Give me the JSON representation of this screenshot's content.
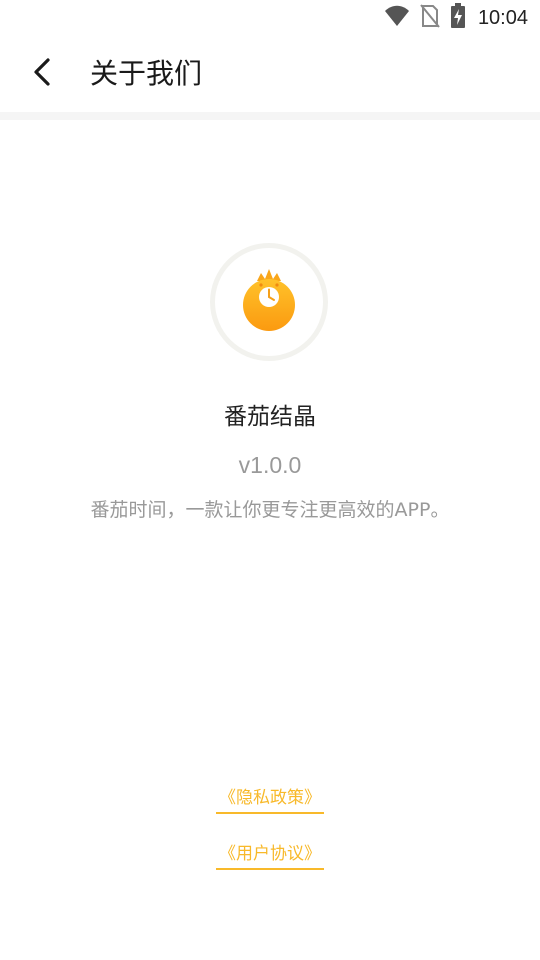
{
  "status_bar": {
    "time": "10:04",
    "icons": [
      "wifi-icon",
      "no-sim-icon",
      "battery-charging-icon"
    ]
  },
  "app_bar": {
    "back_icon": "chevron-left-icon",
    "title": "关于我们"
  },
  "about": {
    "logo_icon": "tomato-clock-logo",
    "app_name": "番茄结晶",
    "version": "v1.0.0",
    "description": "番茄时间，一款让你更专注更高效的APP。"
  },
  "links": {
    "privacy_policy": "《隐私政策》",
    "user_agreement": "《用户协议》"
  },
  "colors": {
    "accent": "#f8b92a",
    "logo_orange": "#fdaa1c",
    "text_primary": "#222222",
    "text_secondary": "#999999"
  }
}
